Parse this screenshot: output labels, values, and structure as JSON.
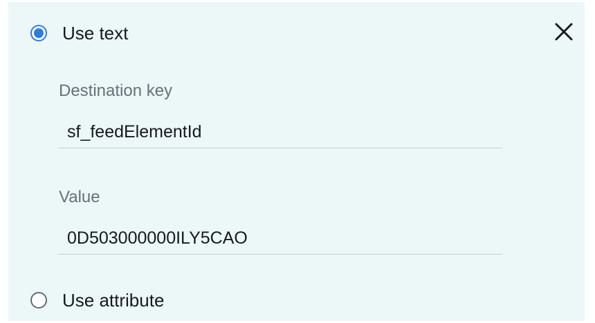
{
  "options": {
    "use_text": {
      "label": "Use text",
      "selected": true
    },
    "use_attribute": {
      "label": "Use attribute",
      "selected": false
    }
  },
  "close": {
    "icon": "close-icon"
  },
  "fields": {
    "destination_key": {
      "label": "Destination key",
      "value": "sf_feedElementId"
    },
    "value": {
      "label": "Value",
      "value": "0D503000000ILY5CAO"
    }
  },
  "colors": {
    "panel_background": "#ecf7f8",
    "accent": "#2a7de1",
    "label_text": "#687078",
    "body_text": "#16191f"
  }
}
